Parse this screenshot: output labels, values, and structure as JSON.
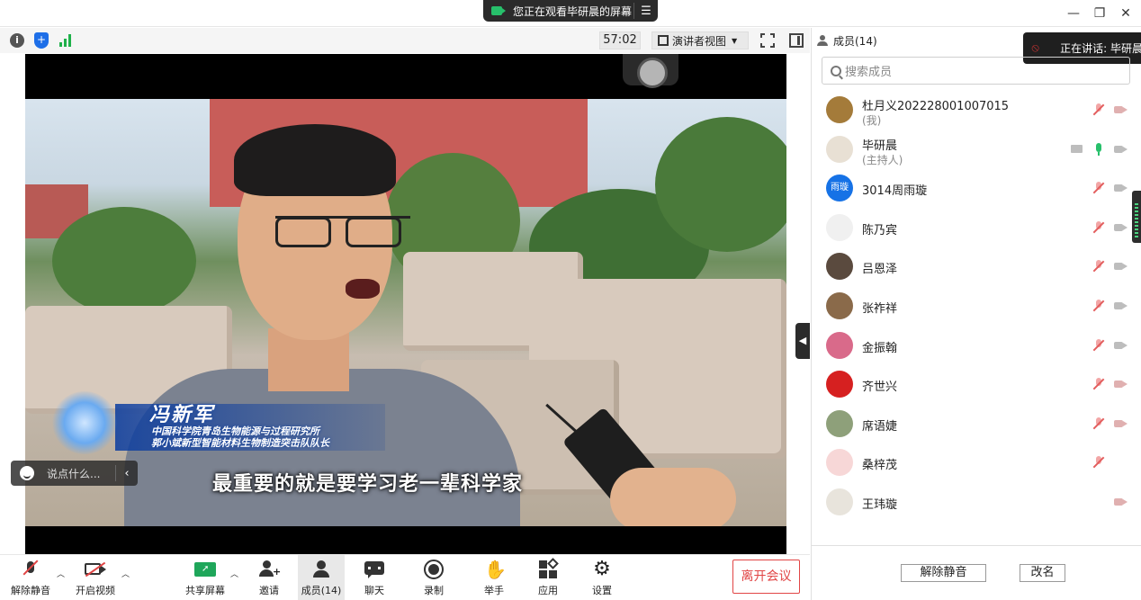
{
  "titlebar": {
    "share_notice": "您正在观看毕研晨的屏幕",
    "minimize": "—",
    "restore": "❐",
    "close": "✕"
  },
  "meeting_bar": {
    "timer": "57:02",
    "view_mode": "演讲者视图"
  },
  "video": {
    "speaker_name": "冯新军",
    "org_line1": "中国科学院青岛生物能源与过程研究所",
    "org_line2": "郭小斌新型智能材料生物制造突击队队长",
    "subtitle": "最重要的就是要学习老一辈科学家"
  },
  "chat_input": {
    "placeholder": "说点什么..."
  },
  "toolbar": {
    "unmute": "解除静音",
    "start_video": "开启视频",
    "share_screen": "共享屏幕",
    "invite": "邀请",
    "members": "成员(14)",
    "chat": "聊天",
    "record": "录制",
    "raise_hand": "举手",
    "apps": "应用",
    "settings": "设置",
    "leave": "离开会议"
  },
  "members_panel": {
    "title": "成员(14)",
    "speaking_label": "正在讲话: 毕研晨",
    "search_placeholder": "搜索成员",
    "members": [
      {
        "name": "杜月义202228001007015",
        "role": "(我)",
        "avatar_color": "#a47b3a",
        "avatar_text": "",
        "mic": "off",
        "cam": "off",
        "screen": false
      },
      {
        "name": "毕研晨",
        "role": "(主持人)",
        "avatar_color": "#e8e0d4",
        "avatar_text": "",
        "mic": "on",
        "cam": "gray",
        "screen": true
      },
      {
        "name": "3014周雨璇",
        "role": "",
        "avatar_color": "#1672e6",
        "avatar_text": "雨璇",
        "mic": "off",
        "cam": "gray",
        "screen": false
      },
      {
        "name": "陈乃宾",
        "role": "",
        "avatar_color": "#f0f0f0",
        "avatar_text": "",
        "mic": "off",
        "cam": "gray",
        "screen": false
      },
      {
        "name": "吕恩泽",
        "role": "",
        "avatar_color": "#5a4a3e",
        "avatar_text": "",
        "mic": "off",
        "cam": "gray",
        "screen": false
      },
      {
        "name": "张祚祥",
        "role": "",
        "avatar_color": "#8a6a4a",
        "avatar_text": "",
        "mic": "off",
        "cam": "gray",
        "screen": false
      },
      {
        "name": "金振翰",
        "role": "",
        "avatar_color": "#d96a8a",
        "avatar_text": "",
        "mic": "off",
        "cam": "gray",
        "screen": false
      },
      {
        "name": "齐世兴",
        "role": "",
        "avatar_color": "#d62020",
        "avatar_text": "",
        "mic": "off",
        "cam": "off",
        "screen": false
      },
      {
        "name": "席语婕",
        "role": "",
        "avatar_color": "#8ea07a",
        "avatar_text": "",
        "mic": "off",
        "cam": "off",
        "screen": false
      },
      {
        "name": "桑梓茂",
        "role": "",
        "avatar_color": "#f7d7d7",
        "avatar_text": "",
        "mic": "off",
        "cam": "none",
        "screen": false
      },
      {
        "name": "王玮璇",
        "role": "",
        "avatar_color": "#e8e4dc",
        "avatar_text": "",
        "mic": "none",
        "cam": "off",
        "screen": false
      }
    ],
    "unmute_button": "解除静音",
    "rename_button": "改名"
  },
  "colors": {
    "accent_green": "#27c06b",
    "leave_red": "#e14545",
    "mic_off_red": "#e35d5d"
  }
}
